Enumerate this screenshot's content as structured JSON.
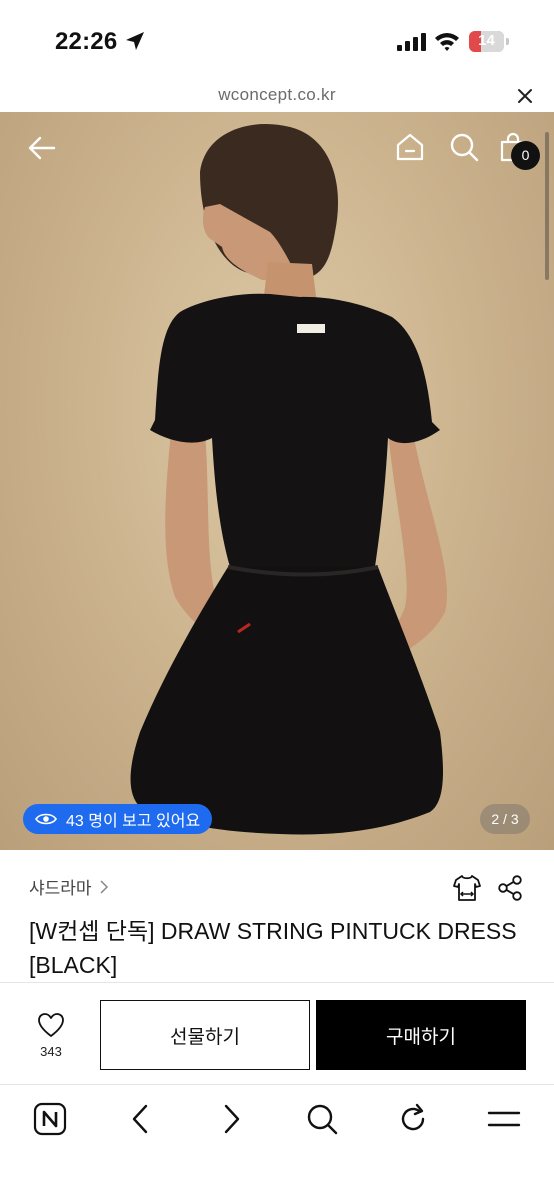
{
  "status_bar": {
    "time": "22:26",
    "battery_level": "14"
  },
  "browser": {
    "url": "wconcept.co.kr"
  },
  "product": {
    "viewers_text": "43 명이 보고 있어요",
    "page_indicator": "2 / 3",
    "cart_count": "0",
    "brand": "샤드라마",
    "title": "[W컨셉 단독] DRAW STRING PINTUCK DRESS [BLACK]",
    "likes": "343"
  },
  "actions": {
    "gift_label": "선물하기",
    "buy_label": "구매하기"
  },
  "icons": {
    "back": "arrow-left-icon",
    "home": "home-icon",
    "search": "search-icon",
    "bag": "shopping-bag-icon",
    "eye": "eye-icon",
    "brand_chevron": "chevron-right-icon",
    "fitting": "shirt-icon",
    "share": "share-icon",
    "like": "heart-icon",
    "naver": "naver-n-icon",
    "nav_back": "chevron-left-icon",
    "nav_forward": "chevron-right-icon",
    "nav_search": "search-icon",
    "reload": "reload-icon",
    "menu": "menu-icon"
  },
  "colors": {
    "viewers_pill": "#1f6bf0",
    "battery": "#e2494b",
    "buy_button": "#000000"
  }
}
